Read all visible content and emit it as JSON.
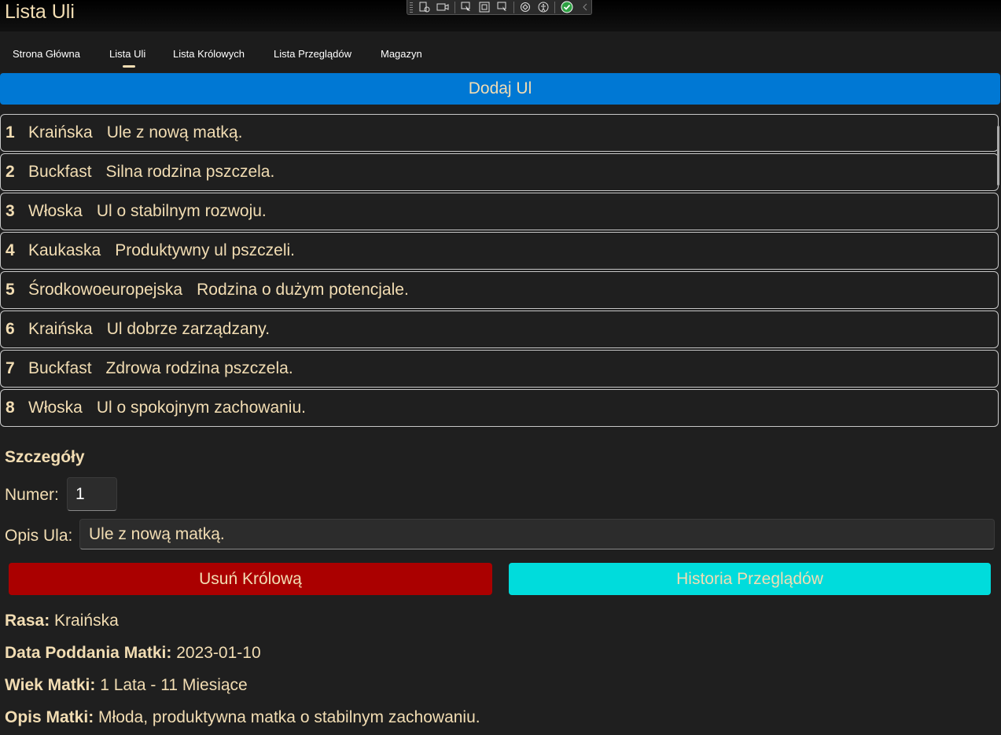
{
  "app": {
    "title": "Lista Uli"
  },
  "nav": {
    "items": [
      {
        "label": "Strona Główna"
      },
      {
        "label": "Lista Uli",
        "selected": true
      },
      {
        "label": "Lista Królowych"
      },
      {
        "label": "Lista Przeglądów"
      },
      {
        "label": "Magazyn"
      }
    ]
  },
  "actions": {
    "add_label": "Dodaj Ul"
  },
  "hives": [
    {
      "numer": "1",
      "rasa": "Kraińska",
      "opis": "Ule z nową matką."
    },
    {
      "numer": "2",
      "rasa": "Buckfast",
      "opis": "Silna rodzina pszczela."
    },
    {
      "numer": "3",
      "rasa": "Włoska",
      "opis": "Ul o stabilnym rozwoju."
    },
    {
      "numer": "4",
      "rasa": "Kaukaska",
      "opis": "Produktywny ul pszczeli."
    },
    {
      "numer": "5",
      "rasa": "Środkowoeuropejska",
      "opis": "Rodzina o dużym potencjale."
    },
    {
      "numer": "6",
      "rasa": "Kraińska",
      "opis": "Ul dobrze zarządzany."
    },
    {
      "numer": "7",
      "rasa": "Buckfast",
      "opis": "Zdrowa rodzina pszczela."
    },
    {
      "numer": "8",
      "rasa": "Włoska",
      "opis": "Ul o spokojnym zachowaniu."
    }
  ],
  "details": {
    "title": "Szczegóły",
    "numer_label": "Numer:",
    "numer_value": "1",
    "opis_label": "Opis Ula:",
    "opis_value": "Ule z nową matką.",
    "delete_label": "Usuń Królową",
    "history_label": "Historia Przeglądów",
    "rasa_label": "Rasa:",
    "rasa_value": "Kraińska",
    "data_label": "Data Poddania Matki:",
    "data_value": "2023-01-10",
    "wiek_label": "Wiek Matki:",
    "wiek_value": "1 Lata - 11 Miesiące",
    "opis_matki_label": "Opis Matki:",
    "opis_matki_value": "Młoda, produktywna matka o stabilnym zachowaniu."
  },
  "colors": {
    "text": "#f2ddb3",
    "accent_blue": "#0078d4",
    "delete_red": "#aa0000",
    "history_cyan": "#00dcdc",
    "background": "#1f1f1f"
  },
  "devtools": {
    "icons": [
      "live-visual-tree-icon",
      "record-icon",
      "select-element-icon",
      "display-layout-adorners-icon",
      "track-focus-icon",
      "hot-reload-icon",
      "accessibility-icon",
      "status-ok-icon",
      "collapse-icon"
    ]
  }
}
